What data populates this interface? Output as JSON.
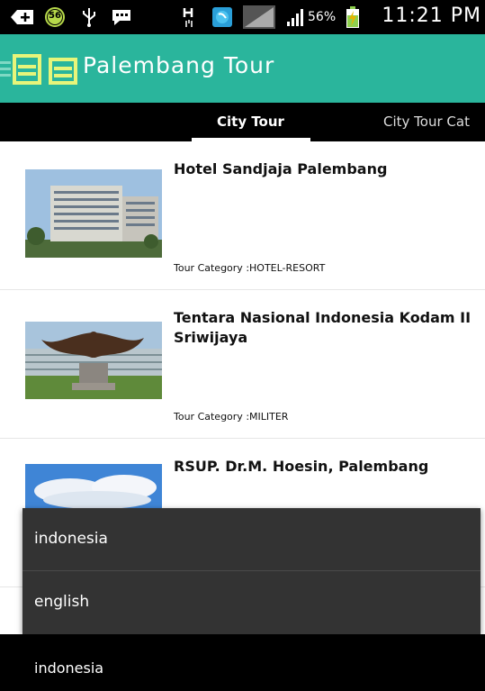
{
  "status_bar": {
    "time": "11:21 PM",
    "battery_percent": "56%",
    "notification_badge": "56",
    "icons": [
      "add-icon",
      "badge-icon",
      "usb-icon",
      "message-icon",
      "hplus-icon",
      "browser-icon",
      "signal-icon",
      "signal-bars-icon",
      "battery-icon"
    ]
  },
  "app_bar": {
    "title": "Palembang Tour",
    "accent_color": "#2ab59c"
  },
  "tabs": [
    {
      "label": "City Tour",
      "selected": true
    },
    {
      "label": "City Tour Cat",
      "selected": false
    }
  ],
  "list": [
    {
      "title": "Hotel Sandjaja Palembang",
      "category": "Tour Category :HOTEL-RESORT"
    },
    {
      "title": "Tentara Nasional Indonesia Kodam II Sriwijaya",
      "category": "Tour Category :MILITER"
    },
    {
      "title": "RSUP. Dr.M. Hoesin, Palembang",
      "category": ""
    }
  ],
  "language_menu": {
    "options": [
      "indonesia",
      "english"
    ]
  },
  "bottom_bar": {
    "selected_language": "indonesia"
  }
}
